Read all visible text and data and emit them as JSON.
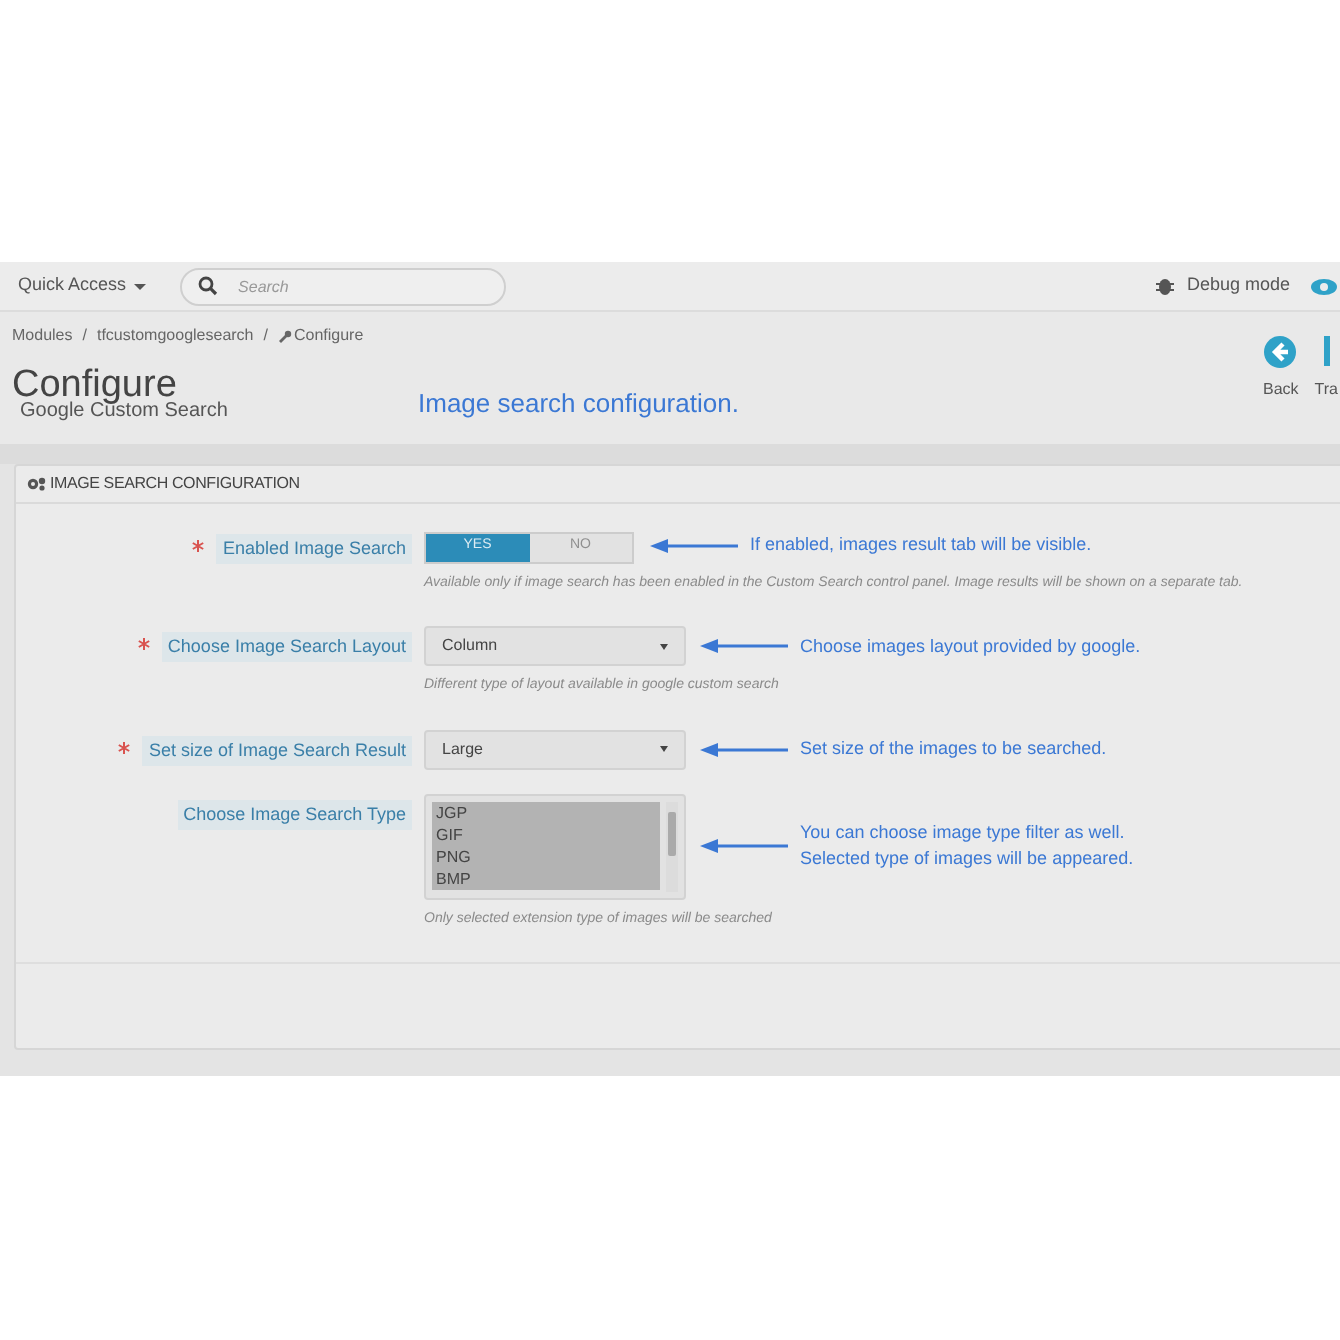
{
  "header": {
    "quick_access": "Quick Access",
    "search": {
      "placeholder": "Search"
    },
    "debug": "Debug mode"
  },
  "breadcrumb": [
    "Modules",
    "/",
    "tfcustomgooglesearch",
    "/",
    "Configure"
  ],
  "page": {
    "title": "Configure",
    "subtitle": "Google Custom Search",
    "note": "Image search configuration."
  },
  "toolbar": [
    {
      "kind": "back",
      "label": "Back"
    },
    {
      "kind": "translate",
      "label": "Tra"
    }
  ],
  "panel": {
    "heading": "IMAGE SEARCH CONFIGURATION",
    "fields": [
      {
        "kind": "toggle",
        "label": "Enabled Image Search",
        "required": true,
        "options": [
          {
            "label": "YES",
            "selected": true
          },
          {
            "label": "NO",
            "selected": false
          }
        ],
        "help": "Available only if image search has been enabled in the Custom Search control panel. Image results will be shown on a separate tab.",
        "annotation": [
          "If enabled, images result tab will be visible."
        ]
      },
      {
        "kind": "select",
        "label": "Choose Image Search Layout",
        "required": true,
        "value": "Column",
        "help": "Different type of layout available in google custom search",
        "annotation": [
          "Choose images layout provided by google."
        ]
      },
      {
        "kind": "select",
        "label": "Set size of Image Search Result",
        "required": true,
        "value": "Large",
        "annotation": [
          "Set size of the images to be searched."
        ]
      },
      {
        "kind": "listbox",
        "label": "Choose Image Search Type",
        "required": false,
        "items": [
          {
            "label": "JGP",
            "selected": true
          },
          {
            "label": "GIF",
            "selected": true
          },
          {
            "label": "PNG",
            "selected": true
          },
          {
            "label": "BMP",
            "selected": true
          }
        ],
        "help": "Only selected extension type of images will be searched",
        "annotation": [
          "You can choose image type filter as well.",
          "Selected type of images will be appeared."
        ]
      }
    ]
  }
}
